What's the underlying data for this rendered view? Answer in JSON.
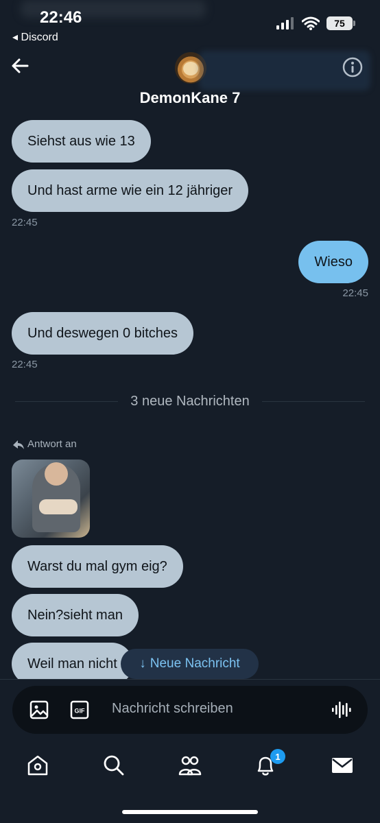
{
  "status_bar": {
    "time": "22:46",
    "back_app": "◂ Discord",
    "battery": "75"
  },
  "header": {
    "name": "DemonKane 7"
  },
  "messages": [
    {
      "id": "m1",
      "text": "Siehst aus wie 13"
    },
    {
      "id": "m2",
      "text": "Und hast arme wie ein 12 jähriger"
    },
    {
      "id": "m3",
      "text": "Wieso"
    },
    {
      "id": "m4",
      "text": "Und deswegen 0 bitches"
    },
    {
      "id": "m5",
      "text": "Warst du mal gym eig?"
    },
    {
      "id": "m6",
      "text": "Nein?sieht man"
    },
    {
      "id": "m7",
      "text": "Weil man nicht"
    }
  ],
  "timestamps": {
    "t1": "22:45",
    "t2": "22:45",
    "t3": "22:45"
  },
  "divider": {
    "label": "3 neue Nachrichten"
  },
  "reply": {
    "label": "Antwort an"
  },
  "new_message_pill": {
    "label": "Neue Nachricht"
  },
  "composer": {
    "placeholder": "Nachricht schreiben"
  },
  "nav": {
    "notification_count": "1"
  },
  "colors": {
    "background": "#151d28",
    "incoming_bubble": "#b6c6d3",
    "outgoing_bubble": "#77c0ee",
    "accent": "#1d9bf0"
  }
}
